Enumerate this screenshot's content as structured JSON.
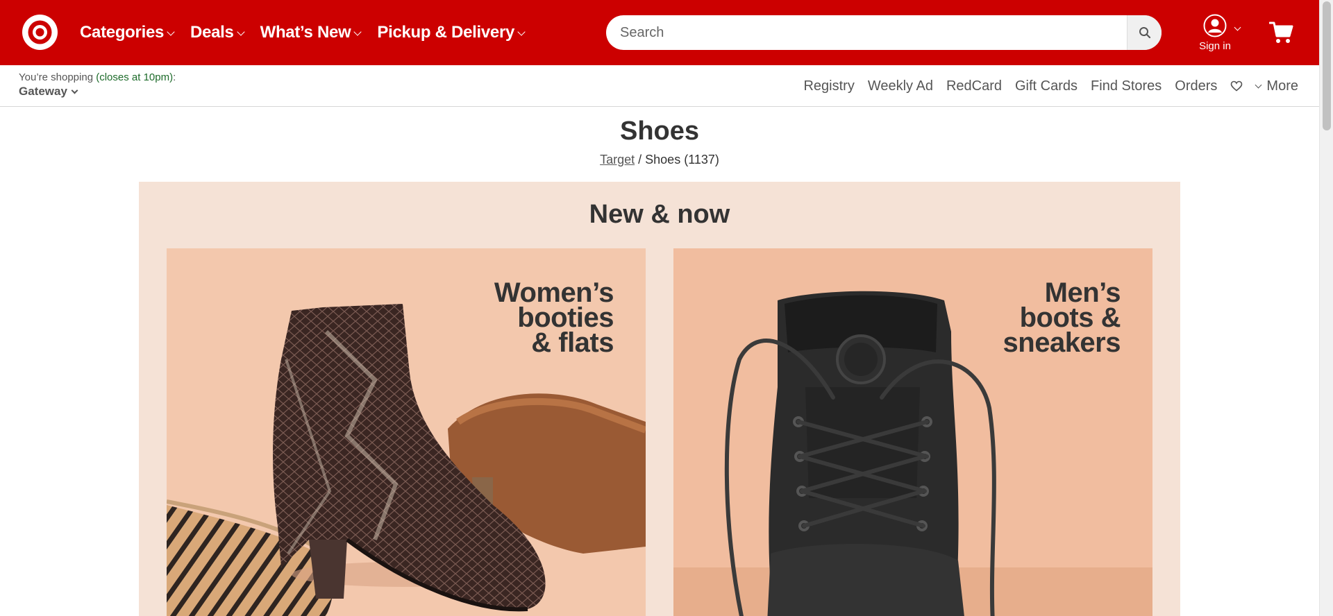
{
  "header": {
    "nav": [
      {
        "label": "Categories"
      },
      {
        "label": "Deals"
      },
      {
        "label": "What’s New"
      },
      {
        "label": "Pickup & Delivery"
      }
    ],
    "search": {
      "placeholder": "Search"
    },
    "sign_in_label": "Sign in",
    "brand_color": "#cc0000"
  },
  "store": {
    "prefix": "You’re shopping ",
    "closes": "(closes at 10pm)",
    "suffix": ":",
    "name": "Gateway"
  },
  "utility_nav": {
    "registry": "Registry",
    "weekly_ad": "Weekly Ad",
    "redcard": "RedCard",
    "gift_cards": "Gift Cards",
    "find_stores": "Find Stores",
    "orders": "Orders",
    "more": "More"
  },
  "page": {
    "title": "Shoes",
    "breadcrumb_root": "Target",
    "breadcrumb_sep": " / ",
    "breadcrumb_current": "Shoes (1137)"
  },
  "promo": {
    "title": "New & now",
    "tiles": [
      {
        "lines": [
          "Women’s",
          "booties",
          "& flats"
        ]
      },
      {
        "lines": [
          "Men’s",
          "boots &",
          "sneakers"
        ]
      }
    ]
  }
}
